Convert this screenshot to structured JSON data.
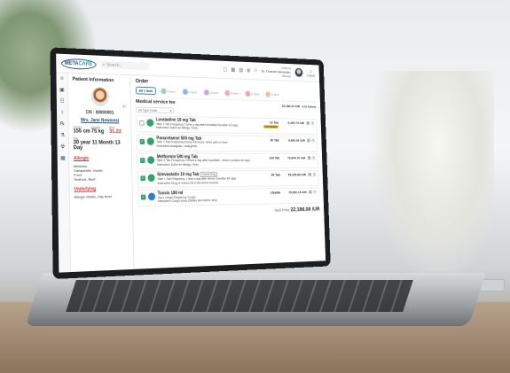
{
  "topbar": {
    "logo_part1": "META",
    "logo_part2": "CARE",
    "search_placeholder": "Search...",
    "doctor_role": "Internal",
    "doctor_name": "Dr. Thomas Hernandez",
    "doctor_sub": "Bishop",
    "logout_label": "Logout"
  },
  "patient": {
    "panel_title": "Patient Information",
    "cn": "CN : 00000001",
    "name": "Mrs. Jane Newmeat",
    "age_badge": "8+",
    "stats": [
      {
        "label": "Height",
        "value": "155",
        "unit": "cm"
      },
      {
        "label": "Weight",
        "value": "75",
        "unit": "kg"
      },
      {
        "label": "BMI",
        "value": "31.22",
        "unit": ""
      }
    ],
    "age_label": "Age",
    "age_value": "30 year 11 Month 13 Day",
    "allergic_title": "Allergic",
    "allergic_body": [
      "Medicine",
      "Gabapentin, Insulin",
      "Food",
      "Seafood, Beef"
    ],
    "underlying_title": "Underlying",
    "underlying_body": "Allergic rhinitis, Hay fever"
  },
  "order": {
    "title": "Order",
    "tabs": [
      {
        "label": "All",
        "count": "1 Item",
        "color": "#ffffff"
      },
      {
        "label": "",
        "count": "0 Item",
        "color": "#9bd3b3"
      },
      {
        "label": "",
        "count": "0 Item",
        "color": "#8fb8e6"
      },
      {
        "label": "",
        "count": "0 Item",
        "color": "#c9a7e6"
      },
      {
        "label": "",
        "count": "0 Item",
        "color": "#f3a9c4"
      },
      {
        "label": "",
        "count": "0 Item",
        "color": "#f1a7a7"
      },
      {
        "label": "",
        "count": "0 Item",
        "color": "#e9c39c"
      }
    ],
    "fee_title": "Medical service fee",
    "fee_total": "22,186.00 /UR",
    "fee_edit": "Edit",
    "fee_delete": "Delete",
    "filter_label": "All Type Order",
    "items": [
      {
        "checked": false,
        "pill_color": "#2fa36b",
        "name": "Loratadine 10 mg Tab",
        "tag": "",
        "line1": "Take 1 Tab  Frequency 1 time a day after breakfast  Duration 10 days",
        "line2": "Instruction Solve an allergy / itchy",
        "qty": "10 Tab",
        "warn": "Unavailable",
        "price": "6,490.70 /UR"
      },
      {
        "checked": true,
        "pill_color": "#2fa36b",
        "name": "Paracetamol 500 mg Tab",
        "tag": "",
        "line1": "Take 1 Tab  Frequency Every 4-6 hours, when pain or fever",
        "line2": "Instruction Analgesic / antipyretic",
        "qty": "20 Tab",
        "warn": "",
        "price": "8,890.90 /UR"
      },
      {
        "checked": true,
        "pill_color": "#2fa36b",
        "name": "Metformin 500 mg Tab",
        "tag": "",
        "line1": "Take 2 Tab  Frequency 2 times a day after breakfast - dinner  Duration 60 days",
        "line2": "Instruction Solve an allergy / itchy",
        "qty": "120 Tab",
        "warn": "",
        "price": "79,944.70 /UR"
      },
      {
        "checked": true,
        "pill_color": "#2fa36b",
        "name": "Simvastatin 10 mg Tab",
        "tag": "Current Drug",
        "line1": "Take 1 Tab  Frequency 1 time a day after dinner  Duration 60 days",
        "line2": "Instruction Drug to reduce fat in the blood vessels",
        "qty": "60 Tab",
        "warn": "",
        "price": "55,395.86 /UR"
      },
      {
        "checked": true,
        "pill_color": "#2a7fd4",
        "name": "Tussis 180 ml",
        "tag": "",
        "line1": "Sip a cough Frequency Cough",
        "line2": "Instruction Cough syrup (Shake well before use)",
        "qty": "1 Bottle",
        "warn": "",
        "price": "79,530.15 /UR"
      }
    ],
    "sum_label": "Sum Price",
    "sum_value": "22,186.00 /UR"
  }
}
